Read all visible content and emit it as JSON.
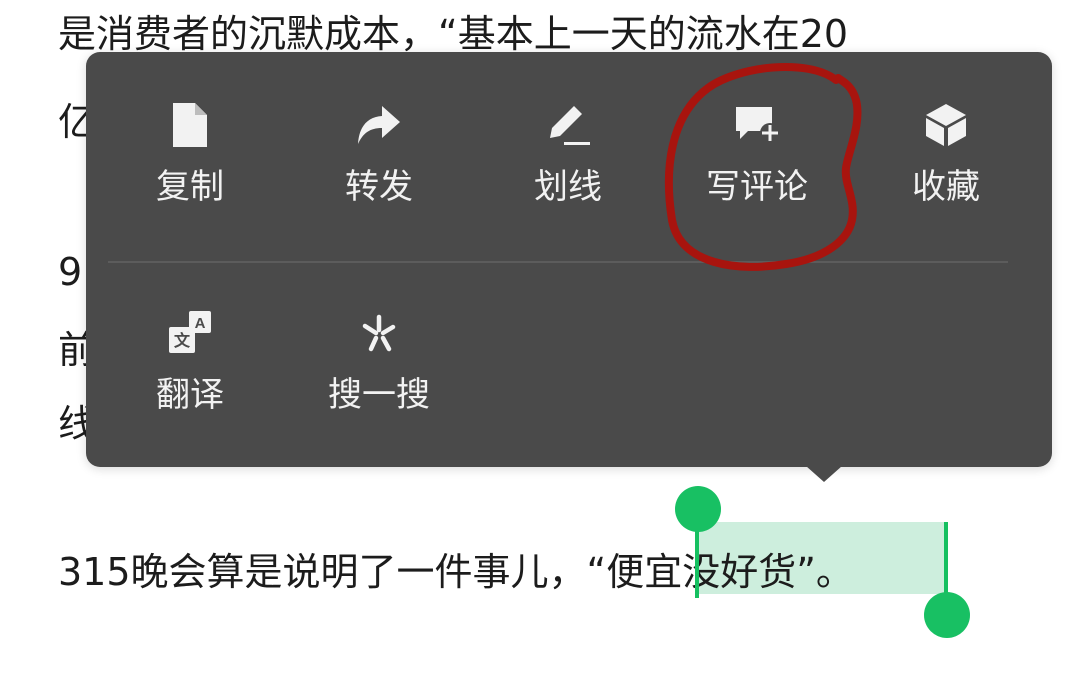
{
  "article": {
    "line1": "是消费者的沉默成本，“基本上一天的流水在20",
    "line2_start": "亿",
    "line3_start": "9",
    "line4_start": "前",
    "line5_start": "线",
    "last_line_before": "315晚会算是说明了一件事儿，“",
    "selected_text": "便宜没好货",
    "last_line_after": "”。"
  },
  "context_menu": {
    "row1": [
      {
        "label": "复制",
        "icon": "document-icon"
      },
      {
        "label": "转发",
        "icon": "forward-icon"
      },
      {
        "label": "划线",
        "icon": "pen-underline-icon"
      },
      {
        "label": "写评论",
        "icon": "comment-add-icon"
      },
      {
        "label": "收藏",
        "icon": "cube-icon"
      }
    ],
    "row2": [
      {
        "label": "翻译",
        "icon": "translate-icon"
      },
      {
        "label": "搜一搜",
        "icon": "search-sparkle-icon"
      }
    ]
  },
  "colors": {
    "menu_bg": "#4a4a4a",
    "selection_bg": "#cdeedd",
    "handle": "#18c063",
    "annotation": "#a8140e"
  }
}
